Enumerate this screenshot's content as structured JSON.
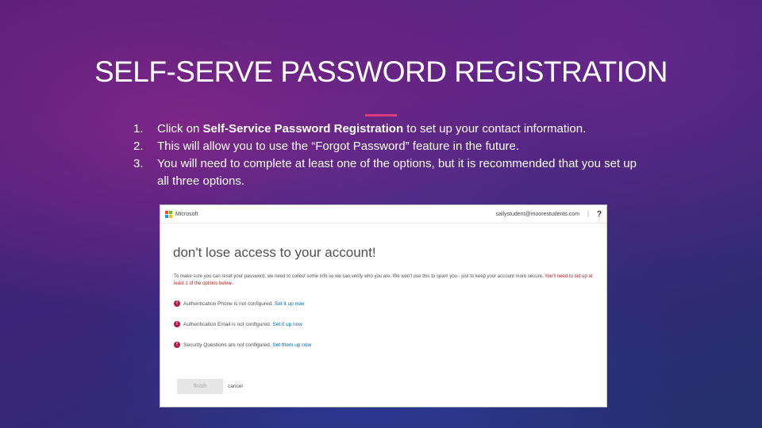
{
  "slide": {
    "title": "SELF-SERVE PASSWORD REGISTRATION",
    "steps": [
      {
        "num": "1.",
        "pre": "Click on ",
        "bold": "Self-Service Password Registration",
        "post": " to set up your contact information."
      },
      {
        "num": "2.",
        "text": "This will allow you to use the “Forgot Password” feature in the future."
      },
      {
        "num": "3.",
        "text": "You will need to complete at least one of the options, but it is recommended that you set up all three options."
      }
    ]
  },
  "screenshot": {
    "brand": "Microsoft",
    "brand_colors": [
      "#f25022",
      "#7fba00",
      "#00a4ef",
      "#ffb900"
    ],
    "account_email": "sallystudent@moorestudents.com",
    "divider": "|",
    "help_label": "?",
    "heading": "don't lose access to your account!",
    "intro": "To make sure you can reset your password, we need to collect some info so we can verify who you are. We won't use this to spam you - just to keep your account more secure.",
    "requirement": "You'll need to set up at least 1 of the options below.",
    "options": [
      {
        "icon": "!",
        "status": "Authentication Phone is not configured.",
        "action": "Set it up now"
      },
      {
        "icon": "!",
        "status": "Authentication Email is not configured.",
        "action": "Set it up now"
      },
      {
        "icon": "!",
        "status": "Security Questions are not configured.",
        "action": "Set them up now"
      }
    ],
    "finish_label": "finish",
    "cancel_label": "cancel"
  }
}
